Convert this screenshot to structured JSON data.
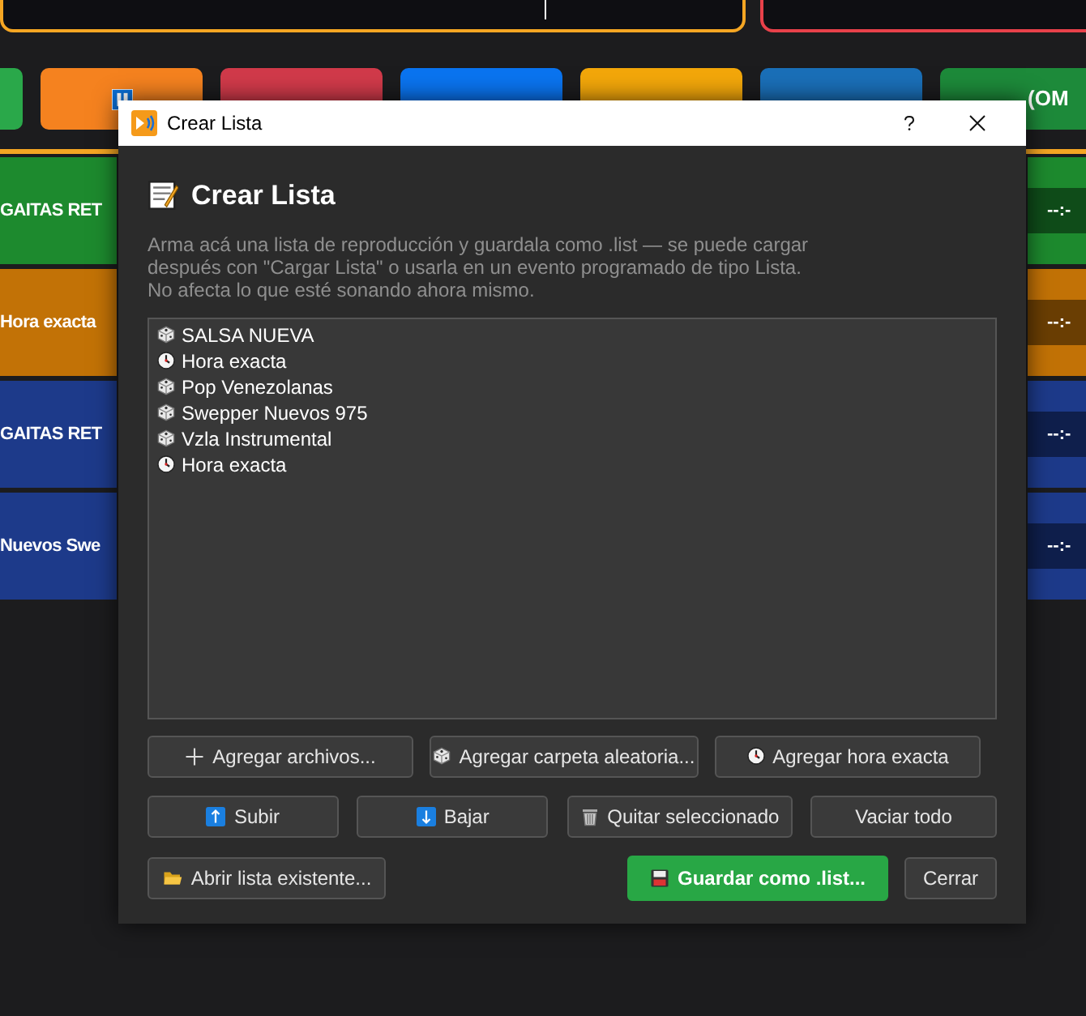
{
  "background": {
    "toolbar_buttons": [
      {
        "color": "#2aa84a"
      },
      {
        "color": "#f5821f",
        "kind": "pause"
      },
      {
        "color": "#d13a4a"
      },
      {
        "color": "#0a74f0"
      },
      {
        "color": "#f3a70a"
      },
      {
        "color": "#1a6fb8"
      },
      {
        "color": "#1d8a3a",
        "text": "(OM"
      }
    ],
    "cards": [
      {
        "title": "GAITAS RET",
        "time": "--:-",
        "color": "#1d8a2e"
      },
      {
        "title": "Hora exacta",
        "time": "--:-",
        "color": "#c27206"
      },
      {
        "title": "GAITAS RET",
        "time": "--:-",
        "color": "#1d3a8a"
      },
      {
        "title": "Nuevos Swe",
        "time": "--:-",
        "color": "#1d3a8a"
      }
    ]
  },
  "dialog": {
    "title": "Crear Lista",
    "heading": "Crear Lista",
    "description": "Arma acá una lista de reproducción y guardala como .list — se puede cargar después con \"Cargar Lista\" o usarla en un evento programado de tipo Lista. No afecta lo que esté sonando ahora mismo.",
    "items": [
      {
        "kind": "folder",
        "label": "SALSA NUEVA"
      },
      {
        "kind": "time",
        "label": "Hora exacta"
      },
      {
        "kind": "folder",
        "label": "Pop Venezolanas"
      },
      {
        "kind": "folder",
        "label": "Swepper Nuevos 975"
      },
      {
        "kind": "folder",
        "label": "Vzla Instrumental"
      },
      {
        "kind": "time",
        "label": "Hora exacta"
      }
    ],
    "button_rows": [
      [
        {
          "kind": "plus",
          "label": "Agregar archivos..."
        },
        {
          "kind": "dice",
          "label": "Agregar carpeta aleatoria..."
        },
        {
          "kind": "clock",
          "label": "Agregar hora exacta"
        }
      ],
      [
        {
          "kind": "up",
          "label": "Subir"
        },
        {
          "kind": "down",
          "label": "Bajar"
        },
        {
          "kind": "trash",
          "label": "Quitar seleccionado"
        },
        {
          "label": "Vaciar todo"
        }
      ]
    ],
    "footer": {
      "open": {
        "kind": "folder",
        "label": "Abrir lista existente..."
      },
      "save": {
        "kind": "floppy",
        "label": "Guardar como .list...",
        "primary": true
      },
      "close": {
        "label": "Cerrar"
      }
    }
  }
}
